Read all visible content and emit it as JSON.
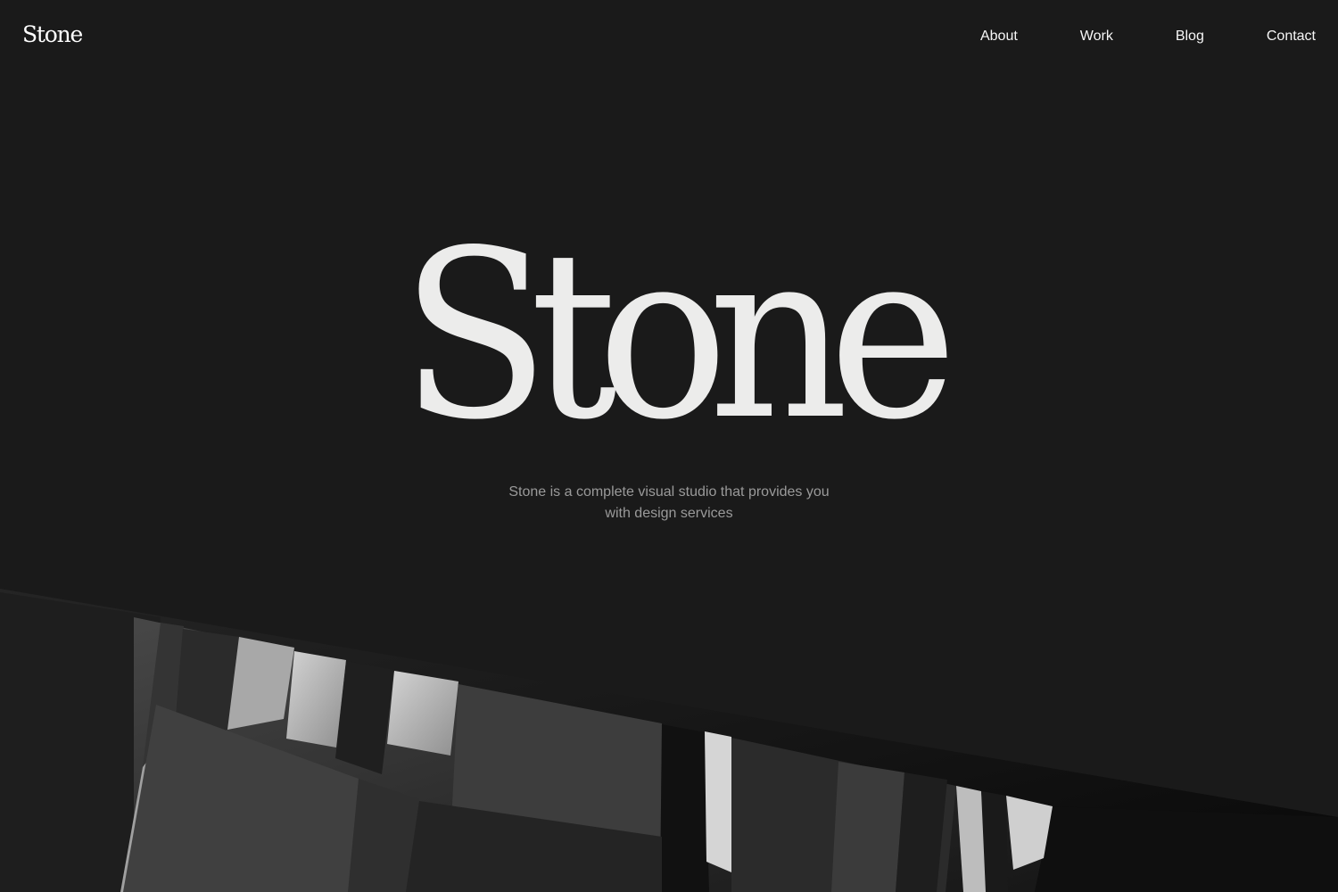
{
  "header": {
    "brand": "Stone",
    "nav": [
      "About",
      "Work",
      "Blog",
      "Contact"
    ]
  },
  "hero": {
    "title": "Stone",
    "subtitle": "Stone is a complete visual studio that provides you with design services"
  },
  "colors": {
    "background": "#1a1a1a",
    "text": "#f1f1f1",
    "muted_text": "#9a9a9a"
  }
}
